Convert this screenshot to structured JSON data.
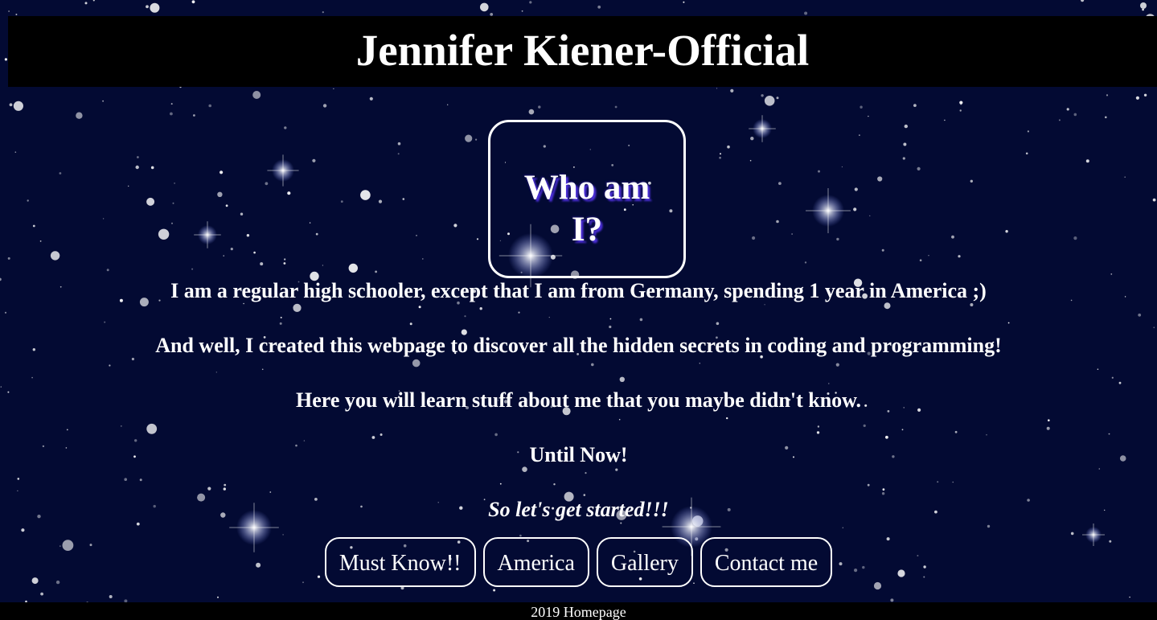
{
  "header": {
    "title": "Jennifer Kiener-Official"
  },
  "about": {
    "heading": "Who am I?"
  },
  "content": {
    "lines": [
      "I am a regular high schooler, except that I am from Germany, spending 1 year in America ;)",
      "And well, I created this webpage to discover all the hidden secrets in coding and programming!",
      "Here you will learn stuff about me that you maybe didn't know.",
      "Until Now!"
    ],
    "call_to_action": "So let's get started!!!"
  },
  "nav": {
    "items": [
      {
        "label": "Must Know!!"
      },
      {
        "label": "America"
      },
      {
        "label": "Gallery"
      },
      {
        "label": "Contact me"
      }
    ]
  },
  "footer": {
    "text": "2019 Homepage"
  },
  "colors": {
    "background": "#030a33",
    "bars": "#000000",
    "text": "#ffffff",
    "heading_shadow": "#4b2fd6"
  },
  "background_image": "night-sky-starfield"
}
